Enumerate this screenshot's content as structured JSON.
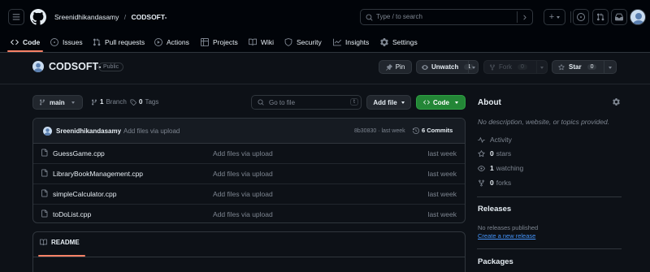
{
  "header": {
    "owner": "Sreenidhikandasamy",
    "separator": "/",
    "repo": "CODSOFT-",
    "search_placeholder": "Type / to search",
    "search_key": "/"
  },
  "nav": {
    "tabs": [
      {
        "label": "Code"
      },
      {
        "label": "Issues"
      },
      {
        "label": "Pull requests"
      },
      {
        "label": "Actions"
      },
      {
        "label": "Projects"
      },
      {
        "label": "Wiki"
      },
      {
        "label": "Security"
      },
      {
        "label": "Insights"
      },
      {
        "label": "Settings"
      }
    ]
  },
  "repo": {
    "name": "CODSOFT-",
    "visibility": "Public",
    "pin_label": "Pin",
    "unwatch_label": "Unwatch",
    "watch_count": "1",
    "fork_label": "Fork",
    "fork_count": "0",
    "star_label": "Star",
    "star_count": "0"
  },
  "toolbar": {
    "branch": "main",
    "branch_count": "1",
    "branch_label": "Branch",
    "tag_count": "0",
    "tag_label": "Tags",
    "goto_placeholder": "Go to file",
    "goto_key": "t",
    "add_file_label": "Add file",
    "code_label": "Code"
  },
  "commit": {
    "author": "Sreenidhikandasamy",
    "message": "Add files via upload",
    "hash_time": "8b30830 · last week",
    "commits_label": "6 Commits"
  },
  "files": [
    {
      "name": "GuessGame.cpp",
      "message": "Add files via upload",
      "time": "last week"
    },
    {
      "name": "LibraryBookManagement.cpp",
      "message": "Add files via upload",
      "time": "last week"
    },
    {
      "name": "simpleCalculator.cpp",
      "message": "Add files via upload",
      "time": "last week"
    },
    {
      "name": "toDoList.cpp",
      "message": "Add files via upload",
      "time": "last week"
    }
  ],
  "readme": {
    "label": "README"
  },
  "sidebar": {
    "about_title": "About",
    "description": "No description, website, or topics provided.",
    "activity_label": "Activity",
    "stars_count": "0",
    "stars_label": "stars",
    "watching_count": "1",
    "watching_label": "watching",
    "forks_count": "0",
    "forks_label": "forks",
    "releases_title": "Releases",
    "no_releases": "No releases published",
    "create_release": "Create a new release",
    "packages_title": "Packages"
  },
  "colors": {
    "background": "#0d1117",
    "header_bg": "#010409",
    "accent_underline": "#f78166",
    "code_button": "#238636",
    "link": "#4493f8"
  }
}
